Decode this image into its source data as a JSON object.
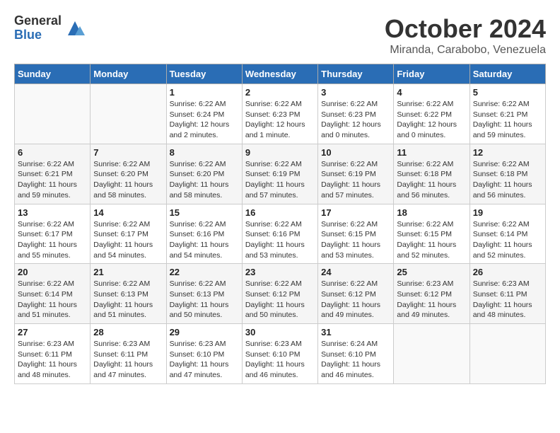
{
  "header": {
    "logo_general": "General",
    "logo_blue": "Blue",
    "month_title": "October 2024",
    "location": "Miranda, Carabobo, Venezuela"
  },
  "weekdays": [
    "Sunday",
    "Monday",
    "Tuesday",
    "Wednesday",
    "Thursday",
    "Friday",
    "Saturday"
  ],
  "weeks": [
    [
      {
        "day": "",
        "info": ""
      },
      {
        "day": "",
        "info": ""
      },
      {
        "day": "1",
        "info": "Sunrise: 6:22 AM\nSunset: 6:24 PM\nDaylight: 12 hours\nand 2 minutes."
      },
      {
        "day": "2",
        "info": "Sunrise: 6:22 AM\nSunset: 6:23 PM\nDaylight: 12 hours\nand 1 minute."
      },
      {
        "day": "3",
        "info": "Sunrise: 6:22 AM\nSunset: 6:23 PM\nDaylight: 12 hours\nand 0 minutes."
      },
      {
        "day": "4",
        "info": "Sunrise: 6:22 AM\nSunset: 6:22 PM\nDaylight: 12 hours\nand 0 minutes."
      },
      {
        "day": "5",
        "info": "Sunrise: 6:22 AM\nSunset: 6:21 PM\nDaylight: 11 hours\nand 59 minutes."
      }
    ],
    [
      {
        "day": "6",
        "info": "Sunrise: 6:22 AM\nSunset: 6:21 PM\nDaylight: 11 hours\nand 59 minutes."
      },
      {
        "day": "7",
        "info": "Sunrise: 6:22 AM\nSunset: 6:20 PM\nDaylight: 11 hours\nand 58 minutes."
      },
      {
        "day": "8",
        "info": "Sunrise: 6:22 AM\nSunset: 6:20 PM\nDaylight: 11 hours\nand 58 minutes."
      },
      {
        "day": "9",
        "info": "Sunrise: 6:22 AM\nSunset: 6:19 PM\nDaylight: 11 hours\nand 57 minutes."
      },
      {
        "day": "10",
        "info": "Sunrise: 6:22 AM\nSunset: 6:19 PM\nDaylight: 11 hours\nand 57 minutes."
      },
      {
        "day": "11",
        "info": "Sunrise: 6:22 AM\nSunset: 6:18 PM\nDaylight: 11 hours\nand 56 minutes."
      },
      {
        "day": "12",
        "info": "Sunrise: 6:22 AM\nSunset: 6:18 PM\nDaylight: 11 hours\nand 56 minutes."
      }
    ],
    [
      {
        "day": "13",
        "info": "Sunrise: 6:22 AM\nSunset: 6:17 PM\nDaylight: 11 hours\nand 55 minutes."
      },
      {
        "day": "14",
        "info": "Sunrise: 6:22 AM\nSunset: 6:17 PM\nDaylight: 11 hours\nand 54 minutes."
      },
      {
        "day": "15",
        "info": "Sunrise: 6:22 AM\nSunset: 6:16 PM\nDaylight: 11 hours\nand 54 minutes."
      },
      {
        "day": "16",
        "info": "Sunrise: 6:22 AM\nSunset: 6:16 PM\nDaylight: 11 hours\nand 53 minutes."
      },
      {
        "day": "17",
        "info": "Sunrise: 6:22 AM\nSunset: 6:15 PM\nDaylight: 11 hours\nand 53 minutes."
      },
      {
        "day": "18",
        "info": "Sunrise: 6:22 AM\nSunset: 6:15 PM\nDaylight: 11 hours\nand 52 minutes."
      },
      {
        "day": "19",
        "info": "Sunrise: 6:22 AM\nSunset: 6:14 PM\nDaylight: 11 hours\nand 52 minutes."
      }
    ],
    [
      {
        "day": "20",
        "info": "Sunrise: 6:22 AM\nSunset: 6:14 PM\nDaylight: 11 hours\nand 51 minutes."
      },
      {
        "day": "21",
        "info": "Sunrise: 6:22 AM\nSunset: 6:13 PM\nDaylight: 11 hours\nand 51 minutes."
      },
      {
        "day": "22",
        "info": "Sunrise: 6:22 AM\nSunset: 6:13 PM\nDaylight: 11 hours\nand 50 minutes."
      },
      {
        "day": "23",
        "info": "Sunrise: 6:22 AM\nSunset: 6:12 PM\nDaylight: 11 hours\nand 50 minutes."
      },
      {
        "day": "24",
        "info": "Sunrise: 6:22 AM\nSunset: 6:12 PM\nDaylight: 11 hours\nand 49 minutes."
      },
      {
        "day": "25",
        "info": "Sunrise: 6:23 AM\nSunset: 6:12 PM\nDaylight: 11 hours\nand 49 minutes."
      },
      {
        "day": "26",
        "info": "Sunrise: 6:23 AM\nSunset: 6:11 PM\nDaylight: 11 hours\nand 48 minutes."
      }
    ],
    [
      {
        "day": "27",
        "info": "Sunrise: 6:23 AM\nSunset: 6:11 PM\nDaylight: 11 hours\nand 48 minutes."
      },
      {
        "day": "28",
        "info": "Sunrise: 6:23 AM\nSunset: 6:11 PM\nDaylight: 11 hours\nand 47 minutes."
      },
      {
        "day": "29",
        "info": "Sunrise: 6:23 AM\nSunset: 6:10 PM\nDaylight: 11 hours\nand 47 minutes."
      },
      {
        "day": "30",
        "info": "Sunrise: 6:23 AM\nSunset: 6:10 PM\nDaylight: 11 hours\nand 46 minutes."
      },
      {
        "day": "31",
        "info": "Sunrise: 6:24 AM\nSunset: 6:10 PM\nDaylight: 11 hours\nand 46 minutes."
      },
      {
        "day": "",
        "info": ""
      },
      {
        "day": "",
        "info": ""
      }
    ]
  ]
}
